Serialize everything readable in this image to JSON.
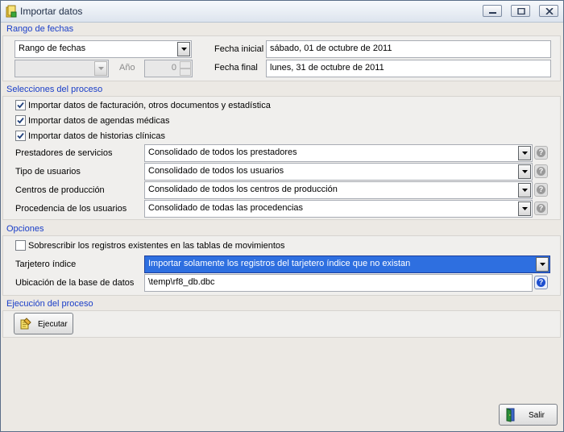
{
  "window": {
    "title": "Importar datos"
  },
  "rango": {
    "section_title": "Rango de fechas",
    "tipo_value": "Rango de fechas",
    "mes_value": "",
    "anio_label": "Año",
    "anio_value": "0",
    "fecha_inicial_label": "Fecha inicial",
    "fecha_inicial_value": "sábado, 01 de octubre de 2011",
    "fecha_final_label": "Fecha final",
    "fecha_final_value": "lunes, 31 de octubre de 2011"
  },
  "selecciones": {
    "section_title": "Selecciones del proceso",
    "checks": [
      {
        "label": "Importar datos de facturación, otros documentos y estadística",
        "checked": true
      },
      {
        "label": "Importar datos de agendas médicas",
        "checked": true
      },
      {
        "label": "Importar datos de historias clínicas",
        "checked": true
      }
    ],
    "rows": [
      {
        "label": "Prestadores de servicios",
        "value": "Consolidado de todos los prestadores"
      },
      {
        "label": "Tipo de usuarios",
        "value": "Consolidado de todos los usuarios"
      },
      {
        "label": "Centros de producción",
        "value": "Consolidado de todos los centros de producción"
      },
      {
        "label": "Procedencia de los usuarios",
        "value": "Consolidado de todas las procedencias"
      }
    ]
  },
  "opciones": {
    "section_title": "Opciones",
    "sobrescribir_label": "Sobrescribir los registros existentes en las tablas de movimientos",
    "sobrescribir_checked": false,
    "tarjetero_label": "Tarjetero índice",
    "tarjetero_value": "Importar solamente los registros del tarjetero índice que no existan",
    "ubicacion_label": "Ubicación de la base de datos",
    "ubicacion_value": "\\temp\\rf8_db.dbc"
  },
  "ejecucion": {
    "section_title": "Ejecución del proceso",
    "ejecutar_label": "Ejecutar"
  },
  "footer": {
    "salir_label": "Salir"
  },
  "colors": {
    "section_title": "#1a3ec8",
    "selection": "#2e6fe0"
  }
}
